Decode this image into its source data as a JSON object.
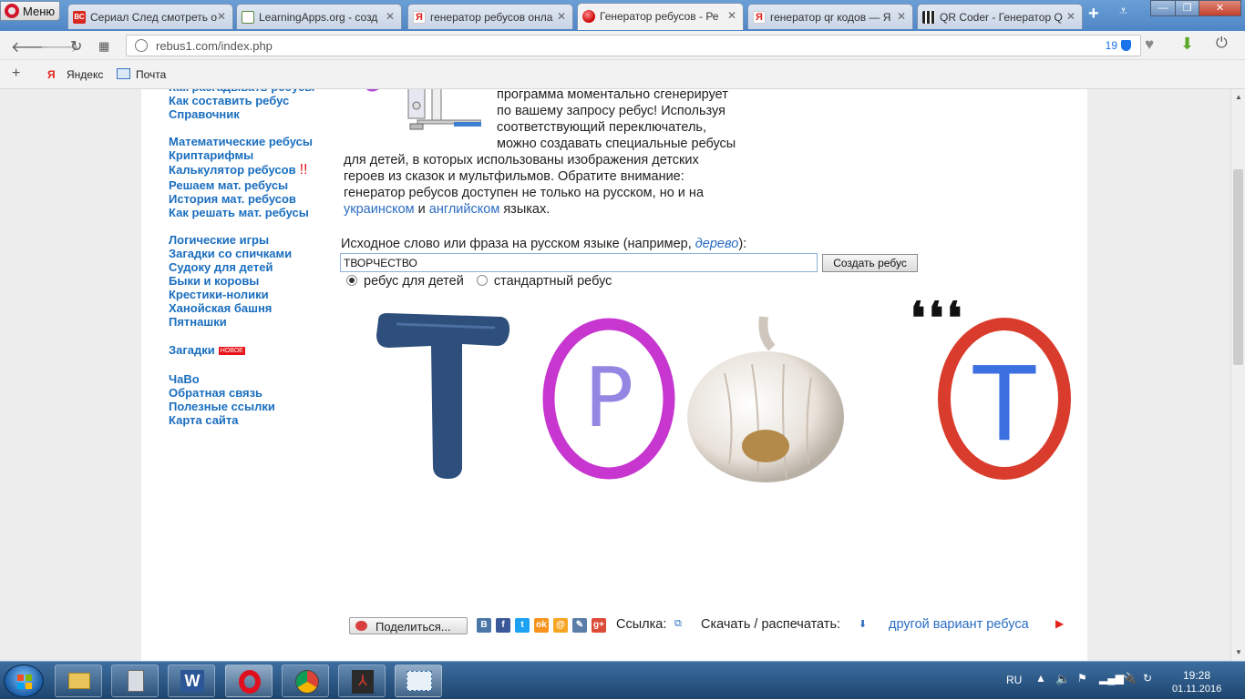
{
  "browser": {
    "menu_label": "Меню",
    "tabs": [
      {
        "title": "Сериал След смотреть о",
        "fav_color": "#d9281f",
        "fav_text": "ВС"
      },
      {
        "title": "LearningApps.org - созд",
        "fav_color": "#5a8a3a",
        "fav_text": ""
      },
      {
        "title": "генератор ребусов онла",
        "fav_color": "#e3231b",
        "fav_text": "Я"
      },
      {
        "title": "Генератор ребусов - Ре",
        "fav_color": "#e3231b",
        "fav_text": ""
      },
      {
        "title": "генератор qr кодов — Я",
        "fav_color": "#e3231b",
        "fav_text": "Я"
      },
      {
        "title": "QR Coder - Генератор Q",
        "fav_color": "#222222",
        "fav_text": ""
      }
    ],
    "url": "rebus1.com/index.php",
    "badge_count": "19",
    "bookmarks": [
      "Яндекс",
      "Почта"
    ]
  },
  "sidebar": {
    "groups": [
      [
        "Как разгадывать ребусы",
        "Как составить ребус",
        "Справочник"
      ],
      [
        "Математические ребусы",
        "Криптарифмы",
        "Калькулятор ребусов",
        "Решаем мат. ребусы",
        "История мат. ребусов",
        "Как решать мат. ребусы"
      ],
      [
        "Логические игры",
        "Загадки со спичками",
        "Судоку для детей",
        "Быки и коровы",
        "Крестики-нолики",
        "Ханойская башня",
        "Пятнашки"
      ],
      [
        "Загадки"
      ],
      [
        "ЧаВо",
        "Обратная связь",
        "Полезные ссылки",
        "Карта сайта"
      ]
    ],
    "new_badge": "НОВОЕ",
    "excl": "!!"
  },
  "article": {
    "line1": "программа моментально сгенерирует",
    "line2": "по вашему запросу ребус! Используя",
    "line3": "соответствующий переключатель,",
    "line4": "можно создавать специальные ребусы",
    "line5": "для детей, в которых использованы изображения детских",
    "line6": "героев из сказок и мультфильмов. Обратите внимание:",
    "line7": "генератор ребусов доступен не только на русском, но и на",
    "link_ua": "украинском",
    "and": "и",
    "link_en": "английском",
    "tail": "языках."
  },
  "form": {
    "label_prefix": "Исходное слово или фраза на русском языке (например,",
    "label_example": "дерево",
    "label_suffix": "):",
    "input_value": "ТВОРЧЕСТВО",
    "button": "Создать ребус",
    "radio_kids": "ребус для детей",
    "radio_std": "стандартный ребус",
    "kids_selected": true
  },
  "rebus": {
    "letter_t": "T",
    "letter_p": "P",
    "letter_t2": "T",
    "commas": "❛❛❛"
  },
  "sharebar": {
    "share_label": "Поделиться...",
    "link_label": "Ссылка:",
    "download_label": "Скачать / распечатать:",
    "other_variant": "другой вариант ребуса",
    "socials": [
      {
        "name": "vk",
        "text": "В",
        "color": "#4a76a8"
      },
      {
        "name": "facebook",
        "text": "f",
        "color": "#3b5998"
      },
      {
        "name": "twitter",
        "text": "t",
        "color": "#1da1f2"
      },
      {
        "name": "odnoklassniki",
        "text": "ok",
        "color": "#f7931e"
      },
      {
        "name": "mail",
        "text": "@",
        "color": "#f5a623"
      },
      {
        "name": "livejournal",
        "text": "✎",
        "color": "#5b7ea8"
      },
      {
        "name": "google-plus",
        "text": "g+",
        "color": "#dd4b39"
      }
    ]
  },
  "taskbar": {
    "lang": "RU",
    "time": "19:28",
    "date": "01.11.2016"
  }
}
